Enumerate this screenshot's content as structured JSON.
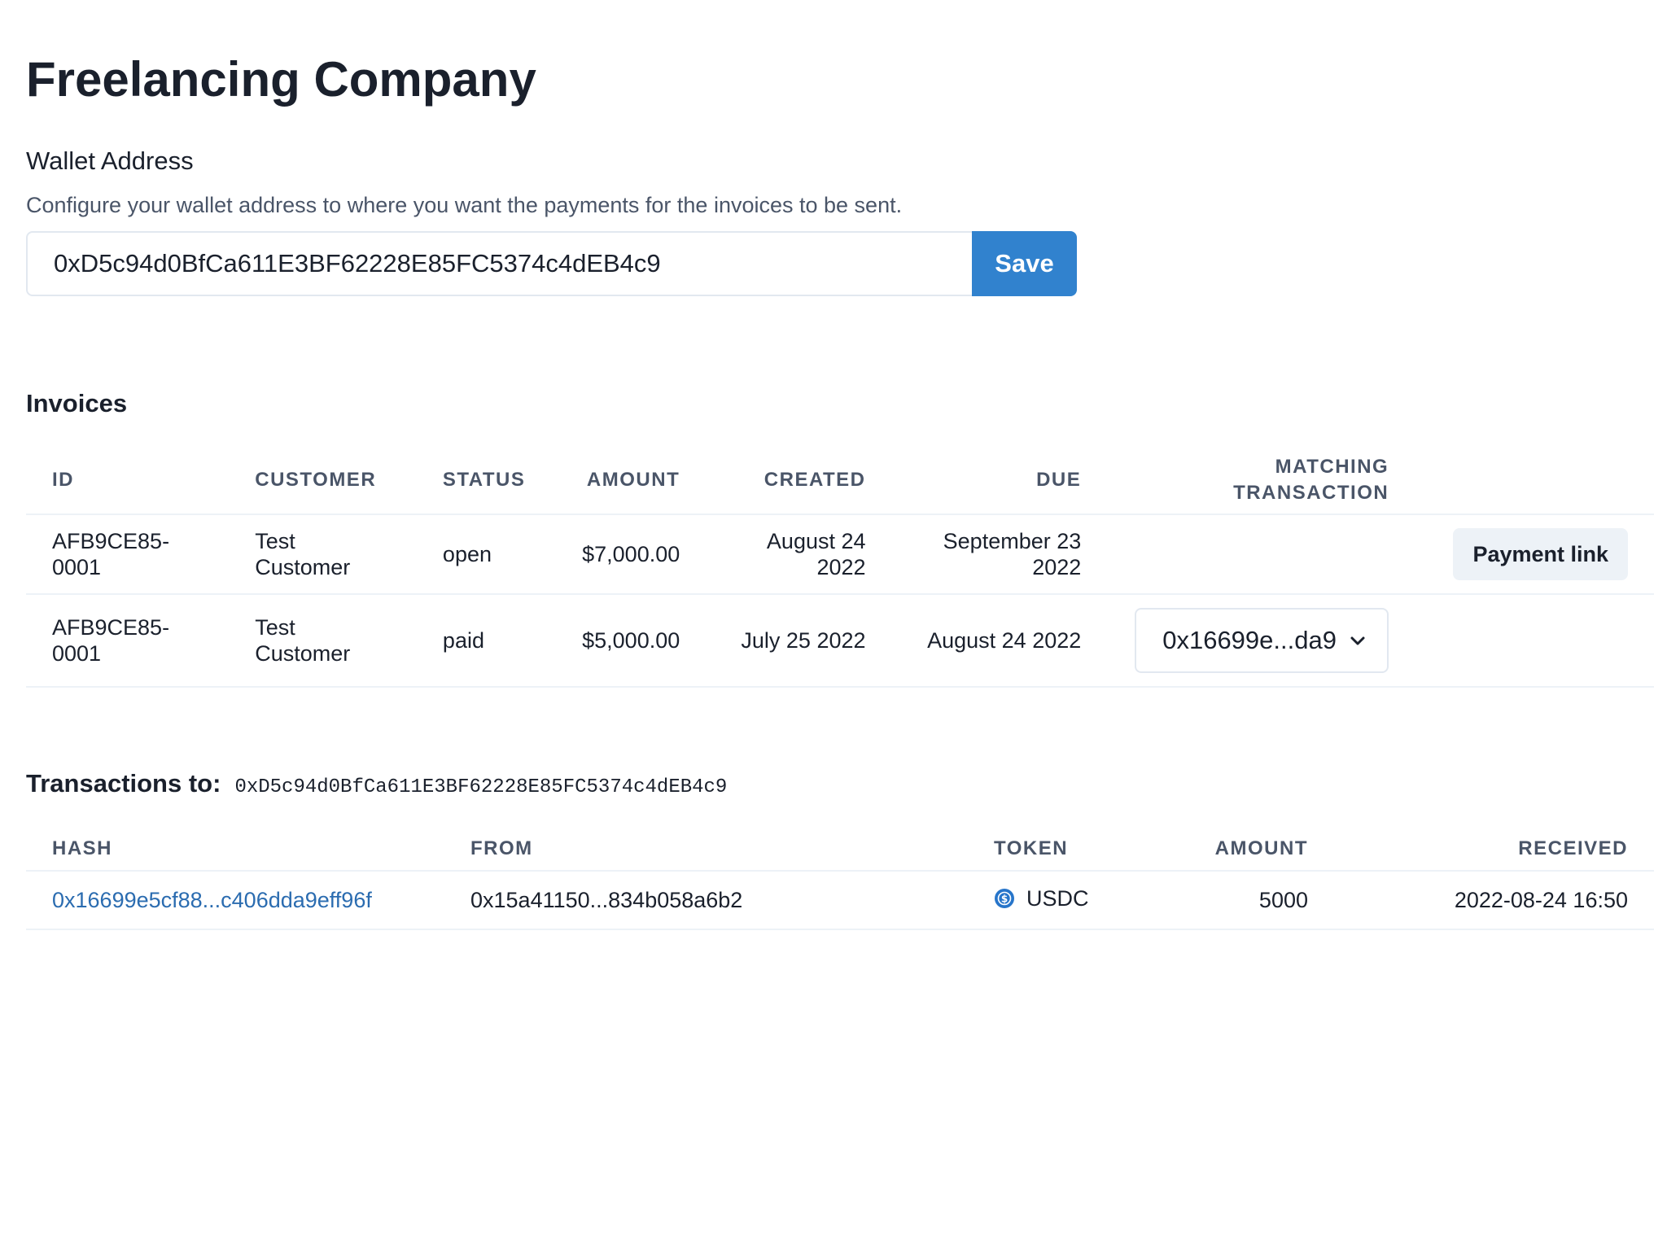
{
  "page": {
    "title": "Freelancing Company"
  },
  "wallet": {
    "label": "Wallet Address",
    "help": "Configure your wallet address to where you want the payments for the invoices to be sent.",
    "address": "0xD5c94d0BfCa611E3BF62228E85FC5374c4dEB4c9",
    "save_label": "Save"
  },
  "invoices": {
    "title": "Invoices",
    "columns": {
      "id": "ID",
      "customer": "CUSTOMER",
      "status": "STATUS",
      "amount": "AMOUNT",
      "created": "CREATED",
      "due": "DUE",
      "matching_1": "MATCHING",
      "matching_2": "TRANSACTION"
    },
    "rows": [
      {
        "id_1": "AFB9CE85-",
        "id_2": "0001",
        "customer_1": "Test",
        "customer_2": "Customer",
        "status": "open",
        "amount": "$7,000.00",
        "created_1": "August 24",
        "created_2": "2022",
        "due_1": "September 23",
        "due_2": "2022",
        "action_label": "Payment link"
      },
      {
        "id_1": "AFB9CE85-",
        "id_2": "0001",
        "customer_1": "Test",
        "customer_2": "Customer",
        "status": "paid",
        "amount": "$5,000.00",
        "created": "July 25 2022",
        "due": "August 24 2022",
        "matching_tx": "0x16699e...da9"
      }
    ]
  },
  "transactions": {
    "title": "Transactions to:",
    "address": "0xD5c94d0BfCa611E3BF62228E85FC5374c4dEB4c9",
    "columns": {
      "hash": "HASH",
      "from": "FROM",
      "token": "TOKEN",
      "amount": "AMOUNT",
      "received": "RECEIVED"
    },
    "rows": [
      {
        "hash": "0x16699e5cf88...c406dda9eff96f",
        "from": "0x15a41150...834b058a6b2",
        "token": "USDC",
        "token_icon": "usdc-icon",
        "amount": "5000",
        "received": "2022-08-24 16:50"
      }
    ]
  },
  "colors": {
    "accent": "#3182ce",
    "link": "#2b6cb0",
    "muted": "#4a5568",
    "border": "#edf2f7"
  }
}
